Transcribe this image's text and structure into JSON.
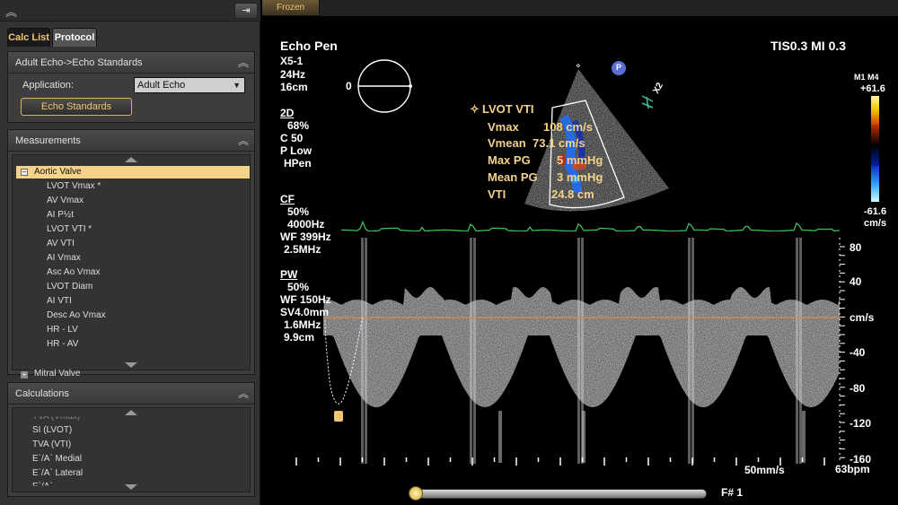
{
  "left_panel": {
    "tabs": [
      "Calc List",
      "Protocol"
    ],
    "standards": {
      "header": "Adult Echo->Echo Standards",
      "application_label": "Application:",
      "application_value": "Adult Echo",
      "button": "Echo Standards"
    },
    "measurements": {
      "header": "Measurements",
      "group": "Aortic Valve",
      "items": [
        "LVOT Vmax *",
        "AV Vmax",
        "AI P½t",
        "LVOT VTI *",
        "AV VTI",
        "AI Vmax",
        "Asc Ao Vmax",
        "LVOT Diam",
        "AI VTI",
        "Desc Ao Vmax",
        "HR - LV",
        "HR - AV"
      ],
      "next_group": "Mitral Valve"
    },
    "calculations": {
      "header": "Calculations",
      "items": [
        "TVA (Vmax)",
        "SI (LVOT)",
        "TVA (VTI)",
        "E`/A` Medial",
        "E`/A` Lateral",
        "E`/A`"
      ]
    }
  },
  "image": {
    "frozen_tab": "Frozen",
    "probe": "Echo Pen",
    "transducer": "X5-1",
    "frame_rate": "24Hz",
    "depth": "16cm",
    "tis_mi": "TIS0.3  MI 0.3",
    "body_marker_angle": "0",
    "orientation_marker": "P",
    "zoom_marker": "X2",
    "modes": {
      "twod": {
        "label": "2D",
        "lines": [
          "68%",
          "C 50",
          "P Low",
          "HPen"
        ]
      },
      "cf": {
        "label": "CF",
        "lines": [
          "50%",
          "4000Hz",
          "WF 399Hz",
          "2.5MHz"
        ]
      },
      "pw": {
        "label": "PW",
        "lines": [
          "50%",
          "WF 150Hz",
          "SV4.0mm",
          "1.6MHz",
          "9.9cm"
        ]
      }
    },
    "colorbar": {
      "top_label": "M1 M4",
      "max": "+61.6",
      "min": "-61.6",
      "unit": "cm/s"
    },
    "measurement": {
      "title": "LVOT VTI",
      "rows": [
        {
          "name": "Vmax",
          "value": "108 cm/s"
        },
        {
          "name": "Vmean",
          "value": "73.1 cm/s"
        },
        {
          "name": "Max PG",
          "value": "5 mmHg"
        },
        {
          "name": "Mean PG",
          "value": "3 mmHg"
        },
        {
          "name": "VTI",
          "value": "24.8 cm"
        }
      ]
    },
    "velocity_axis": {
      "labels": [
        "80",
        "40",
        "cm/s",
        "-40",
        "-80",
        "-120",
        "-160"
      ]
    },
    "sweep_speed": "50mm/s",
    "heart_rate": "63bpm",
    "frame_number": "F#  1",
    "colors": {
      "accent": "#f4d28c",
      "ecg": "#3fbf5a",
      "baseline": "#d08a50",
      "button_border": "#d8b060"
    }
  }
}
